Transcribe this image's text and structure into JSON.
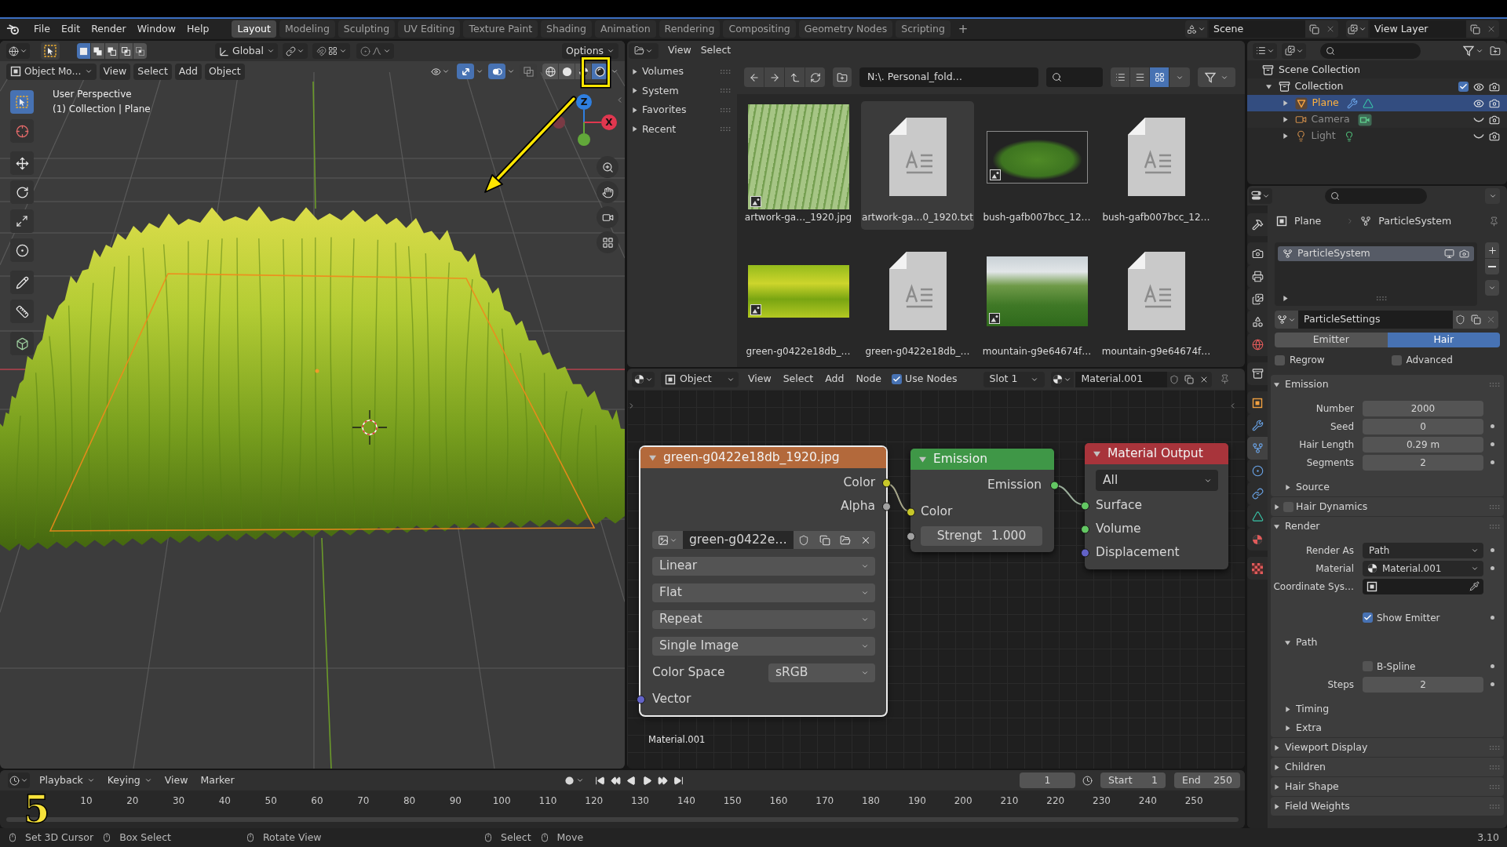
{
  "top_bar": {
    "menus": [
      "File",
      "Edit",
      "Render",
      "Window",
      "Help"
    ],
    "workspaces": [
      {
        "label": "Layout",
        "selected": true
      },
      {
        "label": "Modeling",
        "selected": false
      },
      {
        "label": "Sculpting",
        "selected": false
      },
      {
        "label": "UV Editing",
        "selected": false
      },
      {
        "label": "Texture Paint",
        "selected": false
      },
      {
        "label": "Shading",
        "selected": false
      },
      {
        "label": "Animation",
        "selected": false
      },
      {
        "label": "Rendering",
        "selected": false
      },
      {
        "label": "Compositing",
        "selected": false
      },
      {
        "label": "Geometry Nodes",
        "selected": false
      },
      {
        "label": "Scripting",
        "selected": false
      }
    ],
    "add_workspace": "+",
    "scene": "Scene",
    "view_layer": "View Layer"
  },
  "viewport": {
    "tool_header": {
      "orientation": "Global",
      "options": "Options",
      "select_modes": [
        {
          "kind": "set",
          "selected": true
        },
        {
          "kind": "extend",
          "selected": false
        },
        {
          "kind": "subtract",
          "selected": false
        },
        {
          "kind": "invert",
          "selected": false
        },
        {
          "kind": "intersect",
          "selected": false
        }
      ]
    },
    "header": {
      "mode": "Object Mo…",
      "menus": [
        "View",
        "Select",
        "Add",
        "Object"
      ],
      "toggles": [
        {
          "kind": "gizmos",
          "on": true
        },
        {
          "kind": "overlays",
          "on": true
        },
        {
          "kind": "xray",
          "on": false
        }
      ],
      "shading_modes": [
        {
          "kind": "wireframe",
          "selected": false
        },
        {
          "kind": "solid",
          "selected": false
        },
        {
          "kind": "material",
          "selected": false
        },
        {
          "kind": "rendered",
          "selected": true
        }
      ]
    },
    "overlay_text": [
      "User Perspective",
      "(1) Collection | Plane"
    ],
    "tool_groups": [
      [
        {
          "kind": "select",
          "selected": true
        },
        {
          "kind": "cursor",
          "selected": false
        }
      ],
      [
        {
          "kind": "move",
          "selected": false
        },
        {
          "kind": "rotate",
          "selected": false
        },
        {
          "kind": "scale",
          "selected": false
        },
        {
          "kind": "transform",
          "selected": false
        }
      ],
      [
        {
          "kind": "annotate",
          "selected": false
        },
        {
          "kind": "measure",
          "selected": false
        }
      ],
      [
        {
          "kind": "add_cube",
          "selected": false
        }
      ]
    ],
    "gizmo_axes": [
      {
        "label": "Z",
        "color": "#2f7fe0"
      },
      {
        "label": "X",
        "color": "#e0374f"
      }
    ]
  },
  "annotation": {
    "step": "5"
  },
  "file_browser": {
    "menus": [
      "View",
      "Select"
    ],
    "sidebar": [
      {
        "label": "Volumes",
        "expanded": false
      },
      {
        "label": "System",
        "expanded": false
      },
      {
        "label": "Favorites",
        "expanded": false
      },
      {
        "label": "Recent",
        "expanded": false
      }
    ],
    "path": "N:\\. Personal_fold…",
    "display_modes": [
      {
        "kind": "list",
        "selected": false
      },
      {
        "kind": "columns",
        "selected": false
      },
      {
        "kind": "thumbnails",
        "selected": true
      }
    ],
    "files": [
      {
        "name": "artwork-ga…_1920.jpg",
        "kind": "image",
        "selected": false
      },
      {
        "name": "artwork-ga…0_1920.txt",
        "kind": "text",
        "selected": true
      },
      {
        "name": "bush-gafb007bcc_12…",
        "kind": "image",
        "selected": false
      },
      {
        "name": "bush-gafb007bcc_12…",
        "kind": "text",
        "selected": false
      },
      {
        "name": "green-g0422e18db_…",
        "kind": "image",
        "selected": false
      },
      {
        "name": "green-g0422e18db_…",
        "kind": "text",
        "selected": false
      },
      {
        "name": "mountain-g9e64674f…",
        "kind": "image",
        "selected": false
      },
      {
        "name": "mountain-g9e64674f…",
        "kind": "text",
        "selected": false
      }
    ]
  },
  "node_editor": {
    "header": {
      "object": "Object",
      "menus": [
        "View",
        "Select",
        "Add",
        "Node"
      ],
      "use_nodes": {
        "label": "Use Nodes",
        "checked": true
      },
      "slot": "Slot 1",
      "material": "Material.001"
    },
    "nodes": [
      {
        "kind": "image_texture",
        "title": "green-g0422e18db_1920.jpg",
        "selected": true,
        "expanded": true,
        "outputs": [
          {
            "label": "Color",
            "color": "#c7c729"
          },
          {
            "label": "Alpha",
            "color": "#a1a1a1"
          }
        ],
        "image": "green-g0422e…",
        "options": [
          "Linear",
          "Flat",
          "Repeat",
          "Single Image"
        ],
        "color_space": {
          "label": "Color Space",
          "value": "sRGB"
        },
        "inputs": [
          {
            "label": "Vector",
            "color": "#6363c7"
          }
        ]
      },
      {
        "kind": "emission",
        "title": "Emission",
        "selected": false,
        "expanded": true,
        "outputs": [
          {
            "label": "Emission",
            "color": "#63c763"
          }
        ],
        "inputs": [
          {
            "label": "Color",
            "color": "#c7c729"
          }
        ],
        "strength": {
          "label": "Strengt",
          "value": "1.000",
          "color": "#a1a1a1"
        }
      },
      {
        "kind": "output",
        "title": "Material Output",
        "selected": false,
        "expanded": true,
        "target": "All",
        "inputs": [
          {
            "label": "Surface",
            "color": "#63c763"
          },
          {
            "label": "Volume",
            "color": "#63c763"
          },
          {
            "label": "Displacement",
            "color": "#6363c7"
          }
        ]
      }
    ],
    "material_label": "Material.001"
  },
  "outliner": {
    "tree": [
      {
        "label": "Scene Collection",
        "kind": "scene_collection",
        "selected": false,
        "children": [
          {
            "label": "Collection",
            "kind": "collection",
            "selected": false,
            "expanded": true,
            "checked": true,
            "visible": true,
            "children": [
              {
                "label": "Plane",
                "kind": "mesh",
                "selected": true,
                "expanded": false,
                "visible": true,
                "data_icons": [
                  {
                    "kind": "modifier"
                  },
                  {
                    "kind": "mesh_data"
                  }
                ]
              },
              {
                "label": "Camera",
                "kind": "camera",
                "selected": false,
                "expanded": false,
                "visible": false,
                "data_icons": [
                  {
                    "kind": "camera_data"
                  }
                ]
              },
              {
                "label": "Light",
                "kind": "light",
                "selected": false,
                "expanded": false,
                "visible": false,
                "data_icons": [
                  {
                    "kind": "light_data"
                  }
                ]
              }
            ]
          }
        ]
      }
    ]
  },
  "properties": {
    "tab_groups": [
      [
        {
          "kind": "tool",
          "selected": false
        }
      ],
      [
        {
          "kind": "render",
          "selected": false
        },
        {
          "kind": "output",
          "selected": false
        },
        {
          "kind": "view_layer",
          "selected": false
        },
        {
          "kind": "scene",
          "selected": false
        },
        {
          "kind": "world",
          "selected": false
        }
      ],
      [
        {
          "kind": "collection",
          "selected": false
        }
      ],
      [
        {
          "kind": "object",
          "selected": false
        },
        {
          "kind": "modifiers",
          "selected": false
        },
        {
          "kind": "particles",
          "selected": true
        },
        {
          "kind": "physics",
          "selected": false
        },
        {
          "kind": "constraints",
          "selected": false
        },
        {
          "kind": "data",
          "selected": false
        },
        {
          "kind": "material",
          "selected": false
        }
      ],
      [
        {
          "kind": "texture",
          "selected": false
        }
      ]
    ],
    "breadcrumb": [
      "Plane",
      "ParticleSystem"
    ],
    "systems": [
      {
        "name": "ParticleSystem",
        "selected": true
      }
    ],
    "settings_name": "ParticleSettings",
    "type_tabs": [
      {
        "label": "Emitter",
        "selected": false
      },
      {
        "label": "Hair",
        "selected": true
      }
    ],
    "toggles": [
      {
        "label": "Regrow",
        "checked": false
      },
      {
        "label": "Advanced",
        "checked": false
      }
    ],
    "panels": [
      {
        "title": "Emission",
        "expanded": true,
        "rows": [
          {
            "kind": "number",
            "label": "Number",
            "value": "2000",
            "keyframe": false
          },
          {
            "kind": "number",
            "label": "Seed",
            "value": "0",
            "keyframe": true
          },
          {
            "kind": "number",
            "label": "Hair Length",
            "value": "0.29 m",
            "keyframe": true
          },
          {
            "kind": "number",
            "label": "Segments",
            "value": "2",
            "keyframe": true
          }
        ],
        "subpanels": [
          {
            "title": "Source",
            "expanded": false
          }
        ]
      },
      {
        "title": "Hair Dynamics",
        "expanded": false,
        "checked": false
      },
      {
        "title": "Render",
        "expanded": true,
        "rows": [
          {
            "kind": "dropdown",
            "label": "Render As",
            "value": "Path",
            "keyframe": true
          },
          {
            "kind": "material",
            "label": "Material",
            "value": "Material.001",
            "keyframe": true
          },
          {
            "kind": "object",
            "label": "Coordinate Sys…",
            "keyframe": false
          },
          {
            "kind": "checkbox",
            "label": "Show Emitter",
            "checked": true,
            "keyframe": true
          }
        ],
        "subpanels": [
          {
            "title": "Path",
            "expanded": true,
            "rows": [
              {
                "kind": "checkbox",
                "label": "B-Spline",
                "checked": false,
                "keyframe": true
              },
              {
                "kind": "number",
                "label": "Steps",
                "value": "2",
                "keyframe": true
              }
            ]
          },
          {
            "title": "Timing",
            "expanded": false
          },
          {
            "title": "Extra",
            "expanded": false
          }
        ]
      },
      {
        "title": "Viewport Display",
        "expanded": false
      },
      {
        "title": "Children",
        "expanded": false
      },
      {
        "title": "Hair Shape",
        "expanded": false
      },
      {
        "title": "Field Weights",
        "expanded": false
      }
    ]
  },
  "timeline": {
    "menus": [
      {
        "label": "Playback",
        "kind": "dropdown"
      },
      {
        "label": "Keying",
        "kind": "dropdown"
      },
      {
        "label": "View",
        "kind": "menu"
      },
      {
        "label": "Marker",
        "kind": "menu"
      }
    ],
    "current_frame": "1",
    "start": {
      "label": "Start",
      "value": "1"
    },
    "end": {
      "label": "End",
      "value": "250"
    },
    "ticks": [
      "10",
      "20",
      "30",
      "40",
      "50",
      "60",
      "70",
      "80",
      "90",
      "100",
      "110",
      "120",
      "130",
      "140",
      "150",
      "160",
      "170",
      "180",
      "190",
      "200",
      "210",
      "220",
      "230",
      "240",
      "250"
    ]
  },
  "status_bar": {
    "hint_groups": [
      [
        "Set 3D Cursor",
        "Box Select"
      ],
      [
        "Rotate View"
      ],
      [
        "Select",
        "Move"
      ]
    ],
    "version": "3.10"
  }
}
